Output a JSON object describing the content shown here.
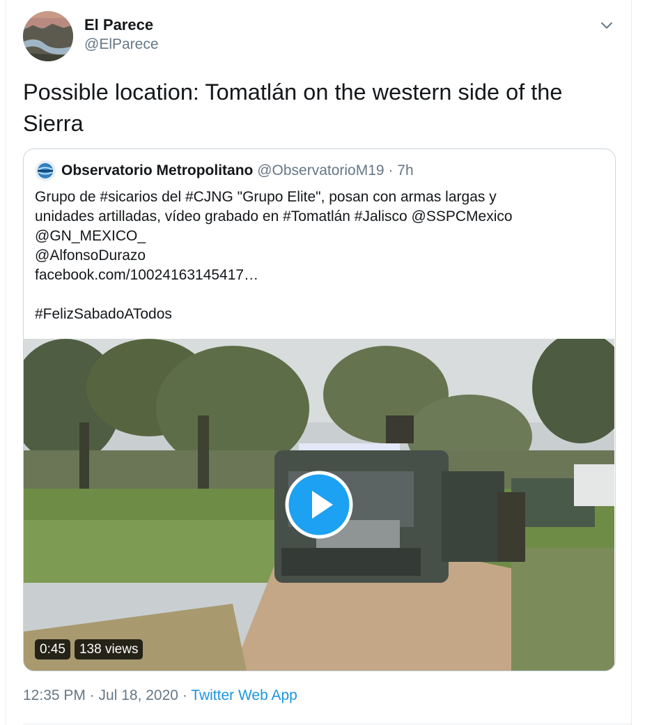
{
  "tweet": {
    "author_name": "El Parece",
    "author_handle": "@ElParece",
    "avatar_icon": "landscape-avatar",
    "caret_icon": "chevron-down-icon",
    "text": "Possible location: Tomatlán on the western side of the Sierra",
    "timestamp": "12:35 PM · Jul 18, 2020",
    "separator": "·",
    "source": "Twitter Web App"
  },
  "quote": {
    "author_name": "Observatorio Metropolitano",
    "author_handle": "@ObservatorioM19",
    "dot": "·",
    "time": "7h",
    "avatar_icon": "globe-avatar",
    "lines": [
      "Grupo de #sicarios del #CJNG \"Grupo Elite\", posan con armas largas y",
      "unidades artilladas, vídeo grabado en #Tomatlán #Jalisco @SSPCMexico",
      "@GN_MEXICO_",
      "@AlfonsoDurazo",
      "facebook.com/10024163145417…",
      "",
      "#FelizSabadoATodos"
    ],
    "video": {
      "duration": "0:45",
      "views": "138 views",
      "play_icon": "play-icon"
    }
  },
  "colors": {
    "text": "#14171a",
    "secondary": "#657786",
    "link": "#1b95e0",
    "border": "#ccd6dd",
    "play": "#1da1f2"
  }
}
